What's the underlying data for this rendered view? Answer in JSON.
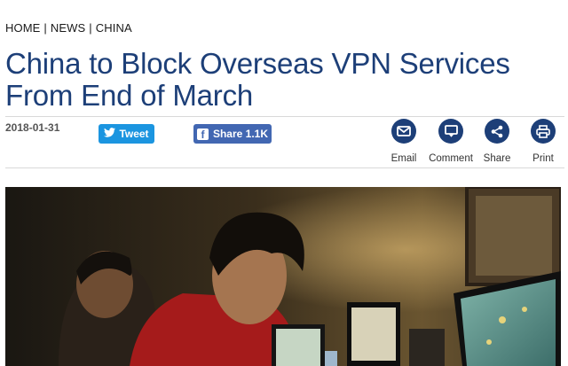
{
  "breadcrumb": {
    "home": "HOME",
    "news": "NEWS",
    "china": "CHINA",
    "separator": "|"
  },
  "article": {
    "title": "China to Block Overseas VPN Services From End of March",
    "date": "2018-01-31"
  },
  "social": {
    "tweet_label": "Tweet",
    "share_label": "Share 1.1K"
  },
  "tools": {
    "email": "Email",
    "comment": "Comment",
    "share": "Share",
    "print": "Print"
  },
  "colors": {
    "title": "#1d3f78",
    "tool_circle": "#1d3f78",
    "twitter": "#1b95e0",
    "facebook": "#4267b2"
  }
}
